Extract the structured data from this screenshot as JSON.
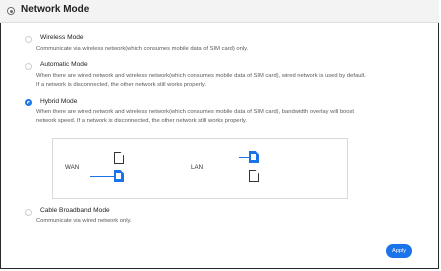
{
  "header": {
    "title": "Network Mode",
    "icon": "gear-icon"
  },
  "modes": [
    {
      "label": "Wireless Mode",
      "selected": false,
      "description": [
        "Communicate via wireless network(which consumes mobile data of SIM card) only."
      ]
    },
    {
      "label": "Automatic Mode",
      "selected": false,
      "description": [
        "When there are wired network and wireless network(which consumes mobile data of SIM card), wired network is used by default.",
        "If a network is disconnected, the other network still works properly."
      ]
    },
    {
      "label": "Hybrid Mode",
      "selected": true,
      "description": [
        "When there are wired network and wireless network(which consumes mobile data of SIM card), bandwidth overlay will boost",
        "network speed. If a network is disconnected, the other network still works properly."
      ]
    },
    {
      "label": "Cable Broadband Mode",
      "selected": false,
      "description": [
        "Communicate via wired network only."
      ]
    }
  ],
  "diagram": {
    "wan_label": "WAN",
    "lan_label": "LAN"
  },
  "actions": {
    "apply_label": "Apply"
  },
  "colors": {
    "accent": "#1a73e8",
    "header_bg": "#f3f3f3"
  }
}
